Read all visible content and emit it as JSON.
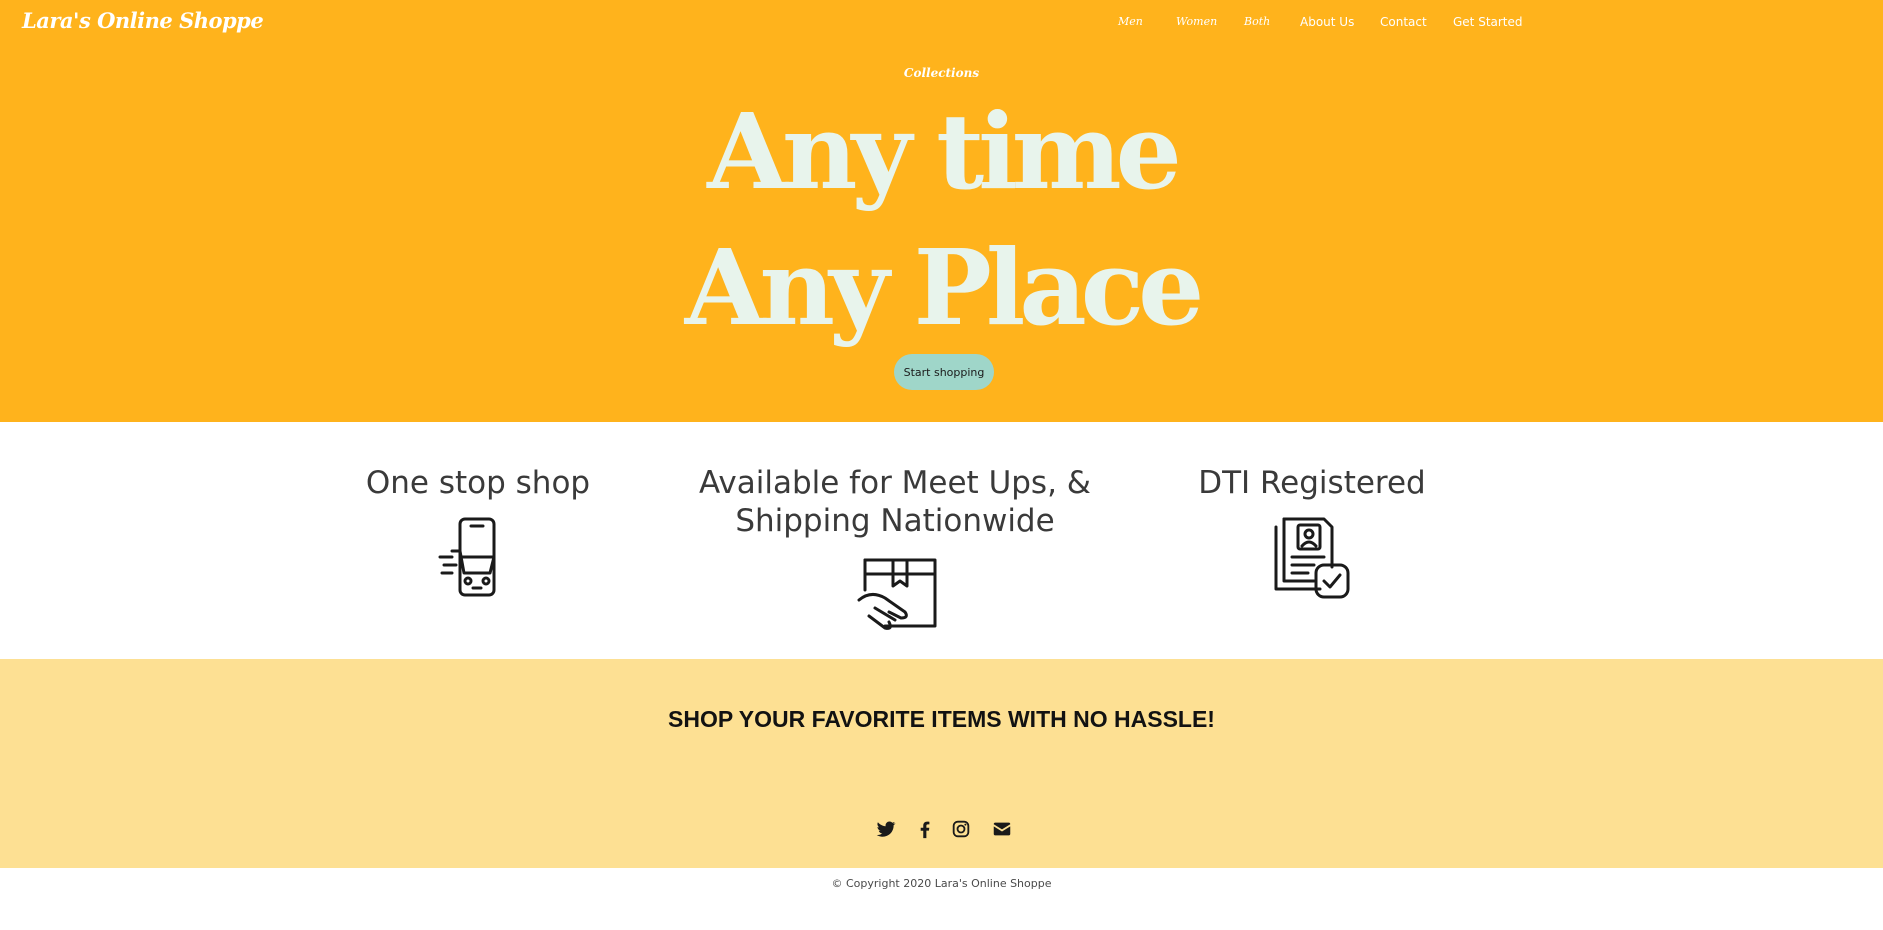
{
  "brand": {
    "name": "Lara's Online Shoppe"
  },
  "nav": {
    "items": [
      {
        "label": "Men"
      },
      {
        "label": "Women"
      },
      {
        "label": "Both"
      },
      {
        "label": "About Us"
      },
      {
        "label": "Contact"
      },
      {
        "label": "Get Started"
      }
    ]
  },
  "hero": {
    "eyebrow": "Collections",
    "headline_line1": "Any time",
    "headline_line2": "Any Place",
    "cta_label": "Start shopping",
    "background_color": "#ffb31c",
    "headline_color": "#e8f4ec",
    "cta_color": "#9fd6c9"
  },
  "features": [
    {
      "title": "One stop shop",
      "icon": "mobile-cart-icon"
    },
    {
      "title_line1": "Available for Meet Ups, &",
      "title_line2": "Shipping Nationwide",
      "icon": "package-handshake-icon"
    },
    {
      "title": "DTI Registered",
      "icon": "registered-document-icon"
    }
  ],
  "banner": {
    "text": "SHOP YOUR FAVORITE ITEMS WITH NO HASSLE!",
    "background_color": "#fde093"
  },
  "social": [
    {
      "icon": "twitter-icon"
    },
    {
      "icon": "facebook-icon"
    },
    {
      "icon": "instagram-icon"
    },
    {
      "icon": "email-icon"
    }
  ],
  "footer": {
    "copyright": "© Copyright 2020 Lara's Online Shoppe"
  }
}
